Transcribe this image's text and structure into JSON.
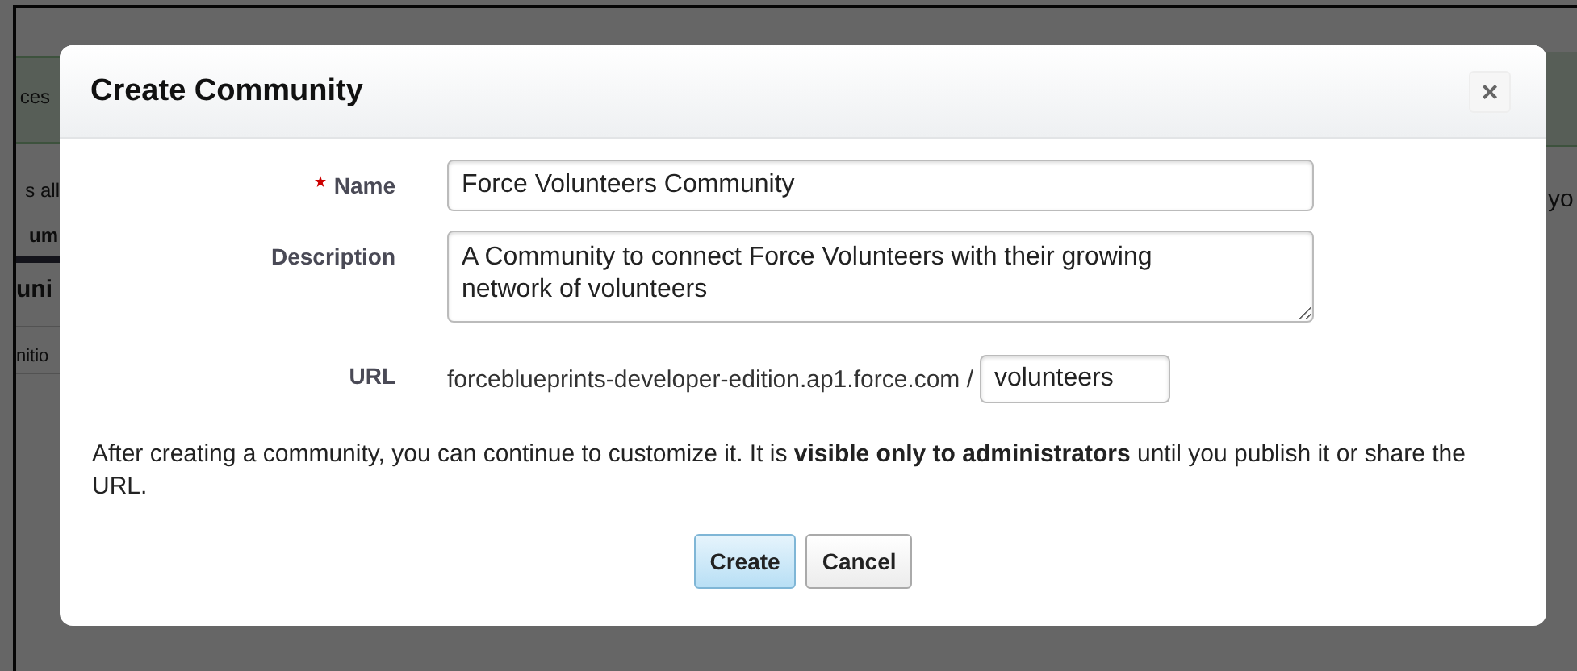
{
  "background_page": {
    "left_fragments": [
      {
        "text": "ces",
        "kind": "banner"
      },
      {
        "text": "s all",
        "kind": "text"
      },
      {
        "text": "um",
        "kind": "tab"
      },
      {
        "text": "uni",
        "kind": "heading"
      },
      {
        "text": "nitio",
        "kind": "row"
      }
    ],
    "right_fragments": [
      {
        "text": "yo",
        "kind": "banner_text"
      }
    ]
  },
  "dialog": {
    "title": "Create Community",
    "close": "×",
    "fields": [
      {
        "label": "Name",
        "required": true,
        "kind": "input",
        "value": "Force Volunteers Community"
      },
      {
        "label": "Description",
        "required": false,
        "kind": "textarea",
        "value": "A Community to connect Force Volunteers with their growing network of volunteers"
      },
      {
        "label": "URL",
        "required": false,
        "kind": "url",
        "prefix": "forceblueprints-developer-edition.ap1.force.com /",
        "value": "volunteers"
      }
    ],
    "note": "After creating a community, you can continue to customize it. It is **visible only to administrators** until you publish it or share the URL.",
    "buttons": [
      {
        "label": "Create",
        "kind": "primary"
      },
      {
        "label": "Cancel",
        "kind": "secondary"
      }
    ]
  }
}
